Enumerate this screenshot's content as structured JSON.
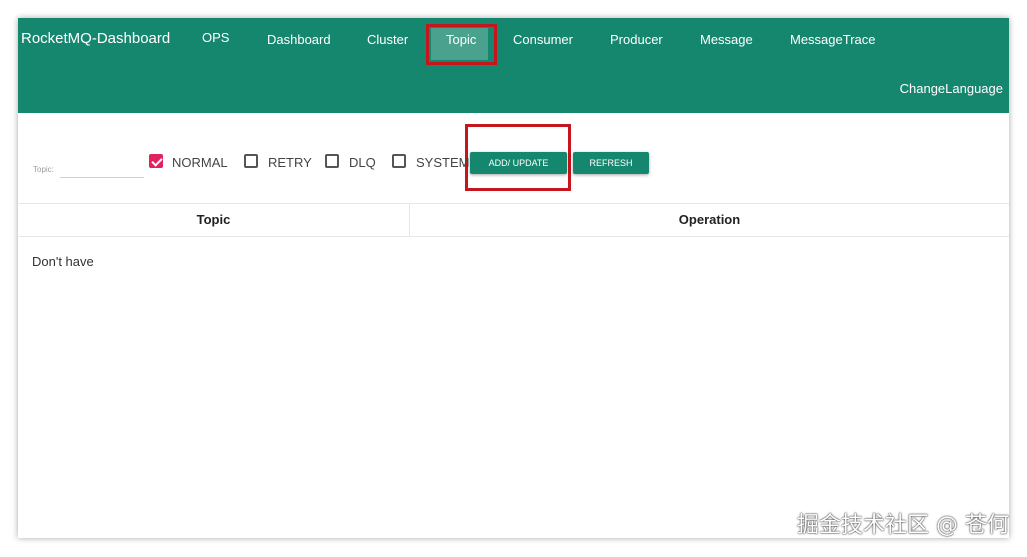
{
  "navbar": {
    "brand": "RocketMQ-Dashboard",
    "items": [
      {
        "label": "OPS"
      },
      {
        "label": "Dashboard"
      },
      {
        "label": "Cluster"
      },
      {
        "label": "Topic",
        "active": true
      },
      {
        "label": "Consumer"
      },
      {
        "label": "Producer"
      },
      {
        "label": "Message"
      },
      {
        "label": "MessageTrace"
      }
    ],
    "change_language": "ChangeLanguage"
  },
  "filter": {
    "topic_label": "Topic:",
    "topic_value": "",
    "checkboxes": [
      {
        "label": "NORMAL",
        "checked": true
      },
      {
        "label": "RETRY",
        "checked": false
      },
      {
        "label": "DLQ",
        "checked": false
      },
      {
        "label": "SYSTEM",
        "checked": false
      }
    ],
    "add_update_label": "ADD/ UPDATE",
    "refresh_label": "REFRESH"
  },
  "table": {
    "columns": [
      "Topic",
      "Operation"
    ],
    "empty_text": "Don't have"
  },
  "watermark": "掘金技术社区 @ 苍何",
  "colors": {
    "primary": "#16876f",
    "active_tab": "#4aa28e",
    "checkbox_checked": "#e0245e",
    "highlight_box": "#c4161c"
  }
}
